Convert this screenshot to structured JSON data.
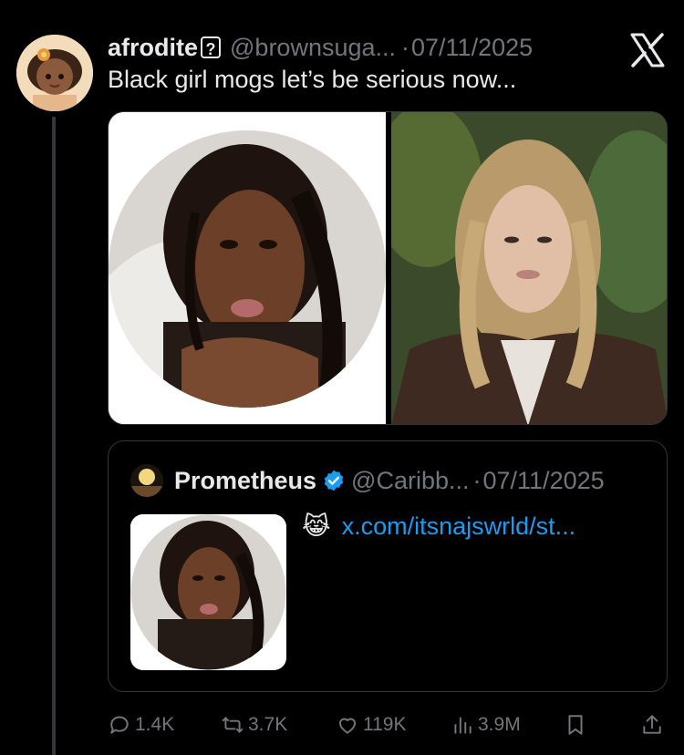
{
  "tweet": {
    "display_name": "afrodite",
    "name_emoji": "?",
    "handle": "@brownsuga...",
    "separator": "·",
    "date": "07/11/2025",
    "text": "Black girl mogs let’s be serious now..."
  },
  "quote": {
    "display_name": "Prometheus",
    "handle": "@Caribb...",
    "separator": "·",
    "date": "07/11/2025",
    "emoji": "😹",
    "link": "x.com/itsnajswrld/st..."
  },
  "actions": {
    "replies": "1.4K",
    "reposts": "3.7K",
    "likes": "119K",
    "views": "3.9M"
  },
  "colors": {
    "background": "#000000",
    "text": "#e7e9ea",
    "muted": "#71767b",
    "link": "#1d9bf0",
    "border": "#333639",
    "verified": "#1d9bf0"
  },
  "icons": [
    "x-logo-icon",
    "reply-icon",
    "repost-icon",
    "like-icon",
    "views-icon",
    "bookmark-icon",
    "share-icon",
    "verified-badge-icon"
  ]
}
